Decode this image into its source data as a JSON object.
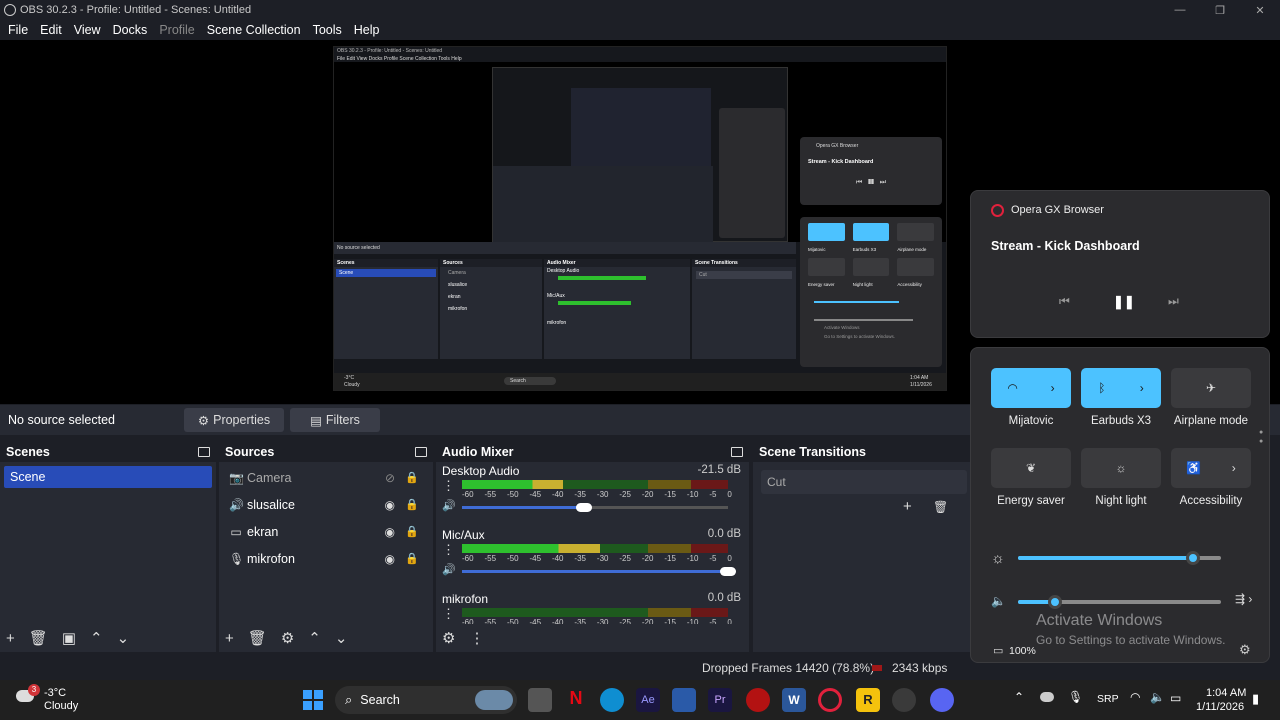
{
  "window": {
    "title": "OBS 30.2.3 - Profile: Untitled - Scenes: Untitled"
  },
  "menu": [
    {
      "label": "File",
      "disabled": false
    },
    {
      "label": "Edit",
      "disabled": false
    },
    {
      "label": "View",
      "disabled": false
    },
    {
      "label": "Docks",
      "disabled": false
    },
    {
      "label": "Profile",
      "disabled": true
    },
    {
      "label": "Scene Collection",
      "disabled": false
    },
    {
      "label": "Tools",
      "disabled": false
    },
    {
      "label": "Help",
      "disabled": false
    }
  ],
  "source_bar": {
    "status": "No source selected",
    "properties": "Properties",
    "filters": "Filters"
  },
  "scenes": {
    "title": "Scenes",
    "items": [
      "Scene"
    ]
  },
  "sources": {
    "title": "Sources",
    "items": [
      {
        "name": "Camera",
        "icon": "camera-icon",
        "hidden": true
      },
      {
        "name": "slusalice",
        "icon": "speaker-icon",
        "hidden": false
      },
      {
        "name": "ekran",
        "icon": "monitor-icon",
        "hidden": false
      },
      {
        "name": "mikrofon",
        "icon": "microphone-icon",
        "hidden": false
      }
    ]
  },
  "mixer": {
    "title": "Audio Mixer",
    "ticks": [
      "-60",
      "-55",
      "-50",
      "-45",
      "-40",
      "-35",
      "-30",
      "-25",
      "-20",
      "-15",
      "-10",
      "-5",
      "0"
    ],
    "channels": [
      {
        "name": "Desktop Audio",
        "db": "-21.5 dB",
        "level": 0.38,
        "volume": 0.46
      },
      {
        "name": "Mic/Aux",
        "db": "0.0 dB",
        "level": 0.52,
        "volume": 1.0
      },
      {
        "name": "mikrofon",
        "db": "0.0 dB",
        "level": 0.0,
        "volume": 1.0
      }
    ]
  },
  "transitions": {
    "title": "Scene Transitions",
    "current": "Cut"
  },
  "status": {
    "dropped": "Dropped Frames 14420 (78.8%)",
    "kbps": "2343 kbps"
  },
  "media": {
    "app": "Opera GX Browser",
    "title": "Stream - Kick Dashboard"
  },
  "quick_settings": {
    "tiles": [
      {
        "label": "Mijatovic",
        "on": true,
        "icon": "wifi-icon"
      },
      {
        "label": "Earbuds X3",
        "on": true,
        "icon": "bluetooth-icon"
      },
      {
        "label": "Airplane mode",
        "on": false,
        "icon": "airplane-icon"
      },
      {
        "label": "Energy saver",
        "on": false,
        "icon": "leaf-icon"
      },
      {
        "label": "Night light",
        "on": false,
        "icon": "sun-icon"
      },
      {
        "label": "Accessibility",
        "on": false,
        "icon": "accessibility-icon"
      }
    ],
    "brightness": 0.86,
    "volume": 0.18,
    "battery": "100%"
  },
  "watermark": {
    "line1": "Activate Windows",
    "line2": "Go to Settings to activate Windows."
  },
  "taskbar": {
    "weather_temp": "-3°C",
    "weather_desc": "Cloudy",
    "weather_badge": "3",
    "search": "Search",
    "lang": "SRP",
    "time": "1:04 AM",
    "date": "1/11/2026"
  },
  "nested": {
    "title": "OBS 30.2.3 - Profile: Untitled - Scenes: Untitled",
    "menu": "File  Edit  View  Docks  Profile  Scene Collection  Tools  Help",
    "nosrc": "No source selected",
    "scenes": "Scenes",
    "sources": "Sources",
    "mixer": "Audio Mixer",
    "transitions": "Scene Transitions",
    "scene": "Scene",
    "src": [
      "Camera",
      "slusalice",
      "ekran",
      "mikrofon"
    ],
    "desktop": "Desktop Audio",
    "mic": "Mic/Aux",
    "mik": "mikrofon",
    "cut": "Cut",
    "opera": "Opera GX Browser",
    "stream": "Stream - Kick Dashboard",
    "t1": "Mijatovic",
    "t2": "Earbuds X3",
    "t3": "Airplane mode",
    "t4": "Energy saver",
    "t5": "Night light",
    "t6": "Accessibility",
    "search": "Search",
    "temp": "-3°C",
    "cloudy": "Cloudy",
    "time": "1:04 AM",
    "date": "1/11/2026",
    "act": "Activate Windows",
    "act2": "Go to Settings to activate Windows."
  },
  "colors": {
    "accent": "#4cc2ff",
    "obs_select": "#284cb8"
  }
}
